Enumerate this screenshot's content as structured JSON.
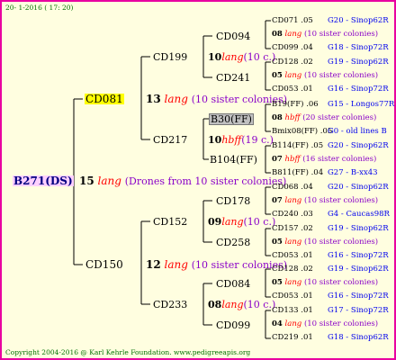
{
  "header": {
    "date": "20-  1-2016 ( 17: 20)"
  },
  "footer": {
    "text": "Copyright 2004-2016 @ Karl Kehrle Foundation.   www.pedigreeapis.org"
  },
  "root": {
    "name": "B271(DS)",
    "count": "15",
    "lang": "lang",
    "note": "(Drones from 10 sister colonies)"
  },
  "gen1": [
    {
      "name": "CD081",
      "count": "13",
      "lang": "lang",
      "note": "(10 sister colonies)"
    },
    {
      "name": "CD150",
      "count": "12",
      "lang": "lang",
      "note": "(10 sister colonies)"
    }
  ],
  "gen2": [
    {
      "name": "CD199",
      "count": "10",
      "lang": "lang",
      "note": "(10 c.)"
    },
    {
      "name": "CD217",
      "count": "10",
      "lang": "hbff",
      "note": "(19 c.)"
    },
    {
      "name": "CD152",
      "count": "09",
      "lang": "lang",
      "note": "(10 c.)"
    },
    {
      "name": "CD233",
      "count": "08",
      "lang": "lang",
      "note": "(10 c.)"
    }
  ],
  "gen3": [
    {
      "name": "CD094"
    },
    {
      "name": "CD241"
    },
    {
      "name": "B30(FF)"
    },
    {
      "name": "B104(FF)"
    },
    {
      "name": "CD178"
    },
    {
      "name": "CD258"
    },
    {
      "name": "CD084"
    },
    {
      "name": "CD099"
    }
  ],
  "gen4": [
    {
      "top": {
        "id": "CD071 .05",
        "src": "G20 - Sinop62R"
      },
      "mid": {
        "count": "08",
        "lang": "lang",
        "note": "(10 sister colonies)"
      },
      "bot": {
        "id": "CD099 .04",
        "src": "G18 - Sinop72R"
      }
    },
    {
      "top": {
        "id": "CD128 .02",
        "src": "G19 - Sinop62R"
      },
      "mid": {
        "count": "05",
        "lang": "lang",
        "note": "(10 sister colonies)"
      },
      "bot": {
        "id": "CD053 .01",
        "src": "G16 - Sinop72R"
      }
    },
    {
      "top": {
        "id": "B19(FF) .06",
        "src": "G15 - Longos77R"
      },
      "mid": {
        "count": "08",
        "lang": "hbff",
        "note": "(20 sister colonies)"
      },
      "bot": {
        "id": "Bmix08(FF) .05",
        "src": "G0 - old lines B"
      }
    },
    {
      "top": {
        "id": "B114(FF) .05",
        "src": "G20 - Sinop62R"
      },
      "mid": {
        "count": "07",
        "lang": "hbff",
        "note": "(16 sister colonies)"
      },
      "bot": {
        "id": "B811(FF) .04",
        "src": "G27 - B-xx43"
      }
    },
    {
      "top": {
        "id": "CD068 .04",
        "src": "G20 - Sinop62R"
      },
      "mid": {
        "count": "07",
        "lang": "lang",
        "note": "(10 sister colonies)"
      },
      "bot": {
        "id": "CD240 .03",
        "src": "G4 - Caucas98R"
      }
    },
    {
      "top": {
        "id": "CD157 .02",
        "src": "G19 - Sinop62R"
      },
      "mid": {
        "count": "05",
        "lang": "lang",
        "note": "(10 sister colonies)"
      },
      "bot": {
        "id": "CD053 .01",
        "src": "G16 - Sinop72R"
      }
    },
    {
      "top": {
        "id": "CD128 .02",
        "src": "G19 - Sinop62R"
      },
      "mid": {
        "count": "05",
        "lang": "lang",
        "note": "(10 sister colonies)"
      },
      "bot": {
        "id": "CD053 .01",
        "src": "G16 - Sinop72R"
      }
    },
    {
      "top": {
        "id": "CD133 .01",
        "src": "G17 - Sinop72R"
      },
      "mid": {
        "count": "04",
        "lang": "lang",
        "note": "(10 sister colonies)"
      },
      "bot": {
        "id": "CD219 .01",
        "src": "G18 - Sinop62R"
      }
    }
  ]
}
